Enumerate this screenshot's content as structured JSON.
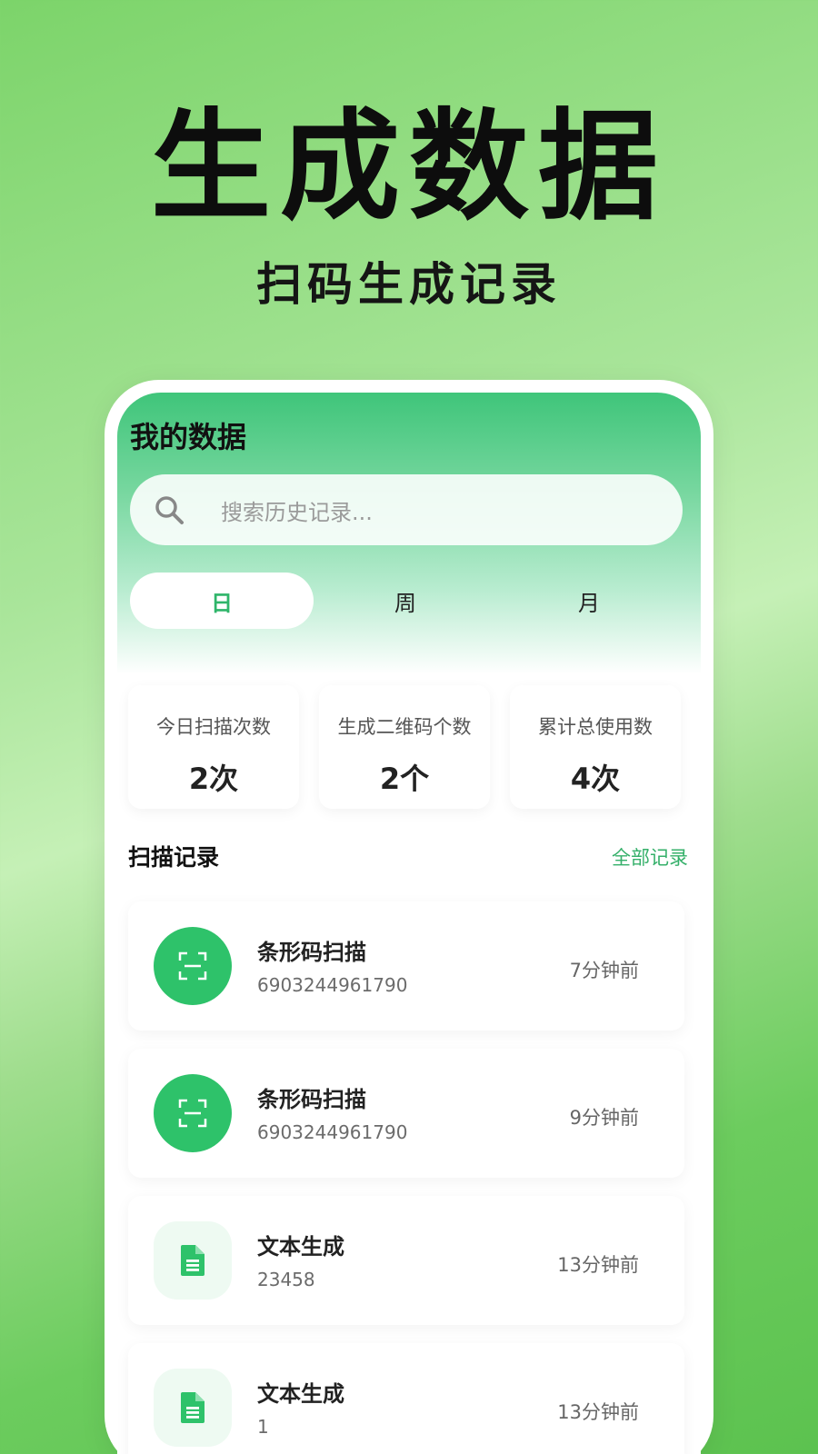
{
  "hero": {
    "title": "生成数据",
    "subtitle": "扫码生成记录"
  },
  "app": {
    "title": "我的数据",
    "search_placeholder": "搜索历史记录...",
    "tabs": [
      {
        "label": "日",
        "active": true
      },
      {
        "label": "周",
        "active": false
      },
      {
        "label": "月",
        "active": false
      }
    ],
    "stats": [
      {
        "label": "今日扫描次数",
        "value": "2次"
      },
      {
        "label": "生成二维码个数",
        "value": "2个"
      },
      {
        "label": "累计总使用数",
        "value": "4次"
      }
    ],
    "section": {
      "title": "扫描记录",
      "link": "全部记录"
    },
    "records": [
      {
        "icon": "scan-frame-icon",
        "title": "条形码扫描",
        "subtitle": "6903244961790",
        "time": "7分钟前"
      },
      {
        "icon": "scan-frame-icon",
        "title": "条形码扫描",
        "subtitle": "6903244961790",
        "time": "9分钟前"
      },
      {
        "icon": "document-icon",
        "title": "文本生成",
        "subtitle": "23458",
        "time": "13分钟前"
      },
      {
        "icon": "document-icon",
        "title": "文本生成",
        "subtitle": "1",
        "time": "13分钟前"
      }
    ]
  },
  "colors": {
    "accent": "#2ec26a",
    "link": "#35b06a"
  }
}
